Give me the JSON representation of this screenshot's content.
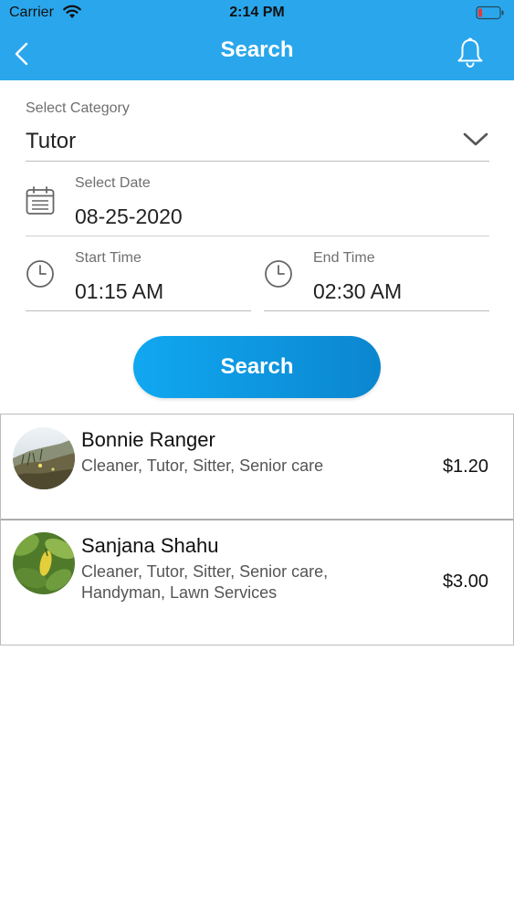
{
  "status_bar": {
    "carrier": "Carrier",
    "time": "2:14 PM"
  },
  "nav": {
    "title": "Search",
    "back_icon": "chevron-left-icon",
    "bell_icon": "bell-icon"
  },
  "form": {
    "category": {
      "label": "Select Category",
      "value": "Tutor"
    },
    "date": {
      "label": "Select Date",
      "value": "08-25-2020"
    },
    "start_time": {
      "label": "Start Time",
      "value": "01:15 AM"
    },
    "end_time": {
      "label": "End Time",
      "value": "02:30 AM"
    },
    "search_label": "Search"
  },
  "results": [
    {
      "name": "Bonnie Ranger",
      "services": " Cleaner, Tutor, Sitter, Senior care",
      "price": "$1.20"
    },
    {
      "name": "Sanjana Shahu",
      "services": " Cleaner, Tutor, Sitter, Senior care, Handyman, Lawn Services",
      "price": "$3.00"
    }
  ],
  "colors": {
    "header": "#2aa7ec",
    "button_start": "#10a8f1",
    "button_end": "#0b86cf",
    "battery_low": "#e53935"
  }
}
